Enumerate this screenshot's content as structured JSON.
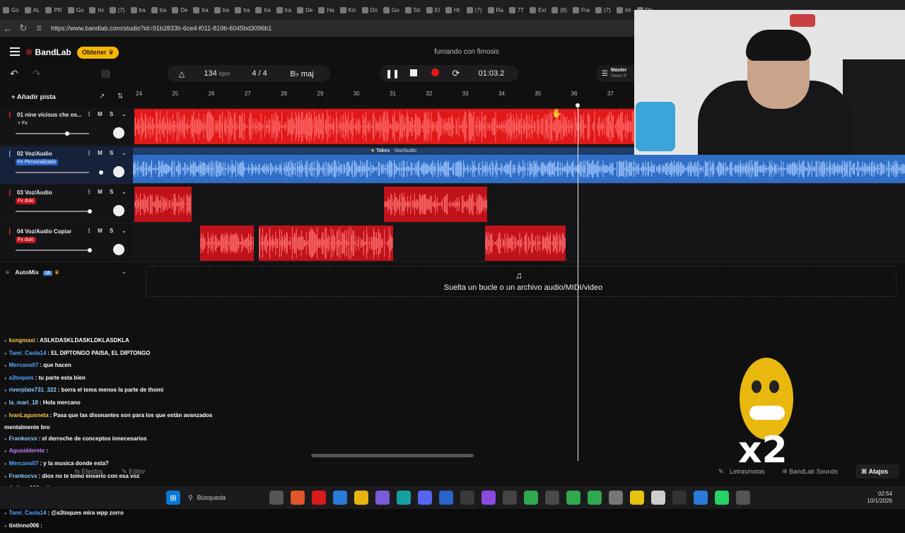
{
  "browser": {
    "tabs": [
      "Go",
      "AL",
      "PR",
      "Go",
      "Ini",
      "(7)",
      "tra",
      "tra",
      "De",
      "tra",
      "tra",
      "tra",
      "tra",
      "tra",
      "De",
      "Ha",
      "Kic",
      "Do",
      "Go",
      "Str",
      "El",
      "Hi:",
      "(7)",
      "Ra",
      "7T",
      "Exi",
      "(8)",
      "Fra",
      "(7)",
      "Im",
      "Rir"
    ],
    "url": "https://www.bandlab.com/studio?id=91b2833b-6ce4-f011-819b-6045bd3096b1"
  },
  "app": {
    "brand": "BandLab",
    "upgrade_label": "Obtener",
    "song_title": "fumando con fimosis",
    "tempo": "134",
    "tempo_unit": "bpm",
    "time_signature": "4 / 4",
    "key": "B♭ maj",
    "time": "01:03.2",
    "master_label": "Master",
    "master_sub": "Select P",
    "add_track_label": "Añadir pista",
    "colors": {
      "accent_red": "#e01818",
      "accent_blue": "#3a7fd8",
      "upgrade": "#f7b500"
    }
  },
  "ruler": [
    "24",
    "25",
    "26",
    "27",
    "28",
    "29",
    "30",
    "31",
    "32",
    "33",
    "34",
    "35",
    "36",
    "37"
  ],
  "tracks": [
    {
      "name": "01  nine vicious che os...",
      "fx": "+ Fx",
      "color": "red"
    },
    {
      "name": "02  Voz/Audio",
      "fx": "Fx Personalizado",
      "color": "blue"
    },
    {
      "name": "03  Voz/Audio",
      "fx": "Fx duki",
      "color": "red"
    },
    {
      "name": "04  Voz/Audio Copiar",
      "fx": "Fx duki",
      "color": "red"
    }
  ],
  "ms": {
    "mute": "M",
    "solo": "S"
  },
  "takes": {
    "label": "Takes",
    "sub": "Voz/Audio"
  },
  "automix": {
    "label": "AutoMix",
    "badge": "IA"
  },
  "dropzone": "Suelta un bucle o un archivo audio/MIDI/video",
  "chat": [
    {
      "user": "kxngmaxi",
      "msg": ": ASLKDASKLDASKLDKLASDKLA",
      "color": "#f7c948"
    },
    {
      "user": "Tami_Casla14",
      "msg": ": EL DIPTONGO PAISA, EL DIPTONGO",
      "color": "#54a6ff"
    },
    {
      "user": "Mercano07",
      "msg": ": que hacen",
      "color": "#54a6ff"
    },
    {
      "user": "a3toques",
      "msg": ": tu parte esta bien",
      "color": "#54a6ff"
    },
    {
      "user": "riverplate731_322",
      "msg": ": borra el tema menos la parte de thomi",
      "color": "#8ecbff"
    },
    {
      "user": "la_mari_18",
      "msg": ": Hola mercano",
      "color": "#8ecbff"
    },
    {
      "user": "IvanLagusneta",
      "msg": ": Pasa que las disonantes son para los que están avanzados mentalmente bro",
      "color": "#f7c948"
    },
    {
      "user": "Frankocvx",
      "msg": ": el derroche de conceptos innecesarios",
      "color": "#8ecbff"
    },
    {
      "user": "Agusalderete",
      "msg": ":",
      "color": "#c07cff"
    },
    {
      "user": "Mercano07",
      "msg": ": y la musica donde esta?",
      "color": "#54a6ff"
    },
    {
      "user": "Frankocvx",
      "msg": ": dios no te tomo enserio con esa voz",
      "color": "#8ecbff"
    },
    {
      "user": "tintinno006",
      "msg": ": eiten",
      "color": "#ffffff"
    },
    {
      "user": "Agusalderete",
      "msg": ":",
      "color": "#c07cff"
    },
    {
      "user": "Tami_Casla14",
      "msg": ": @a3toques mira wpp zorro",
      "color": "#54a6ff"
    },
    {
      "user": "tintinno006",
      "msg": ": ",
      "color": "#ffffff"
    }
  ],
  "bottom": {
    "effects": "Efectos",
    "editor": "Editor",
    "lyrics": "Letras/notas",
    "sounds": "BandLab Sounds",
    "shortcuts": "Atajos"
  },
  "overlay": {
    "multiplier": "x2"
  },
  "taskbar": {
    "search": "Búsqueda",
    "time": "02:54",
    "date": "10/1/2026"
  }
}
